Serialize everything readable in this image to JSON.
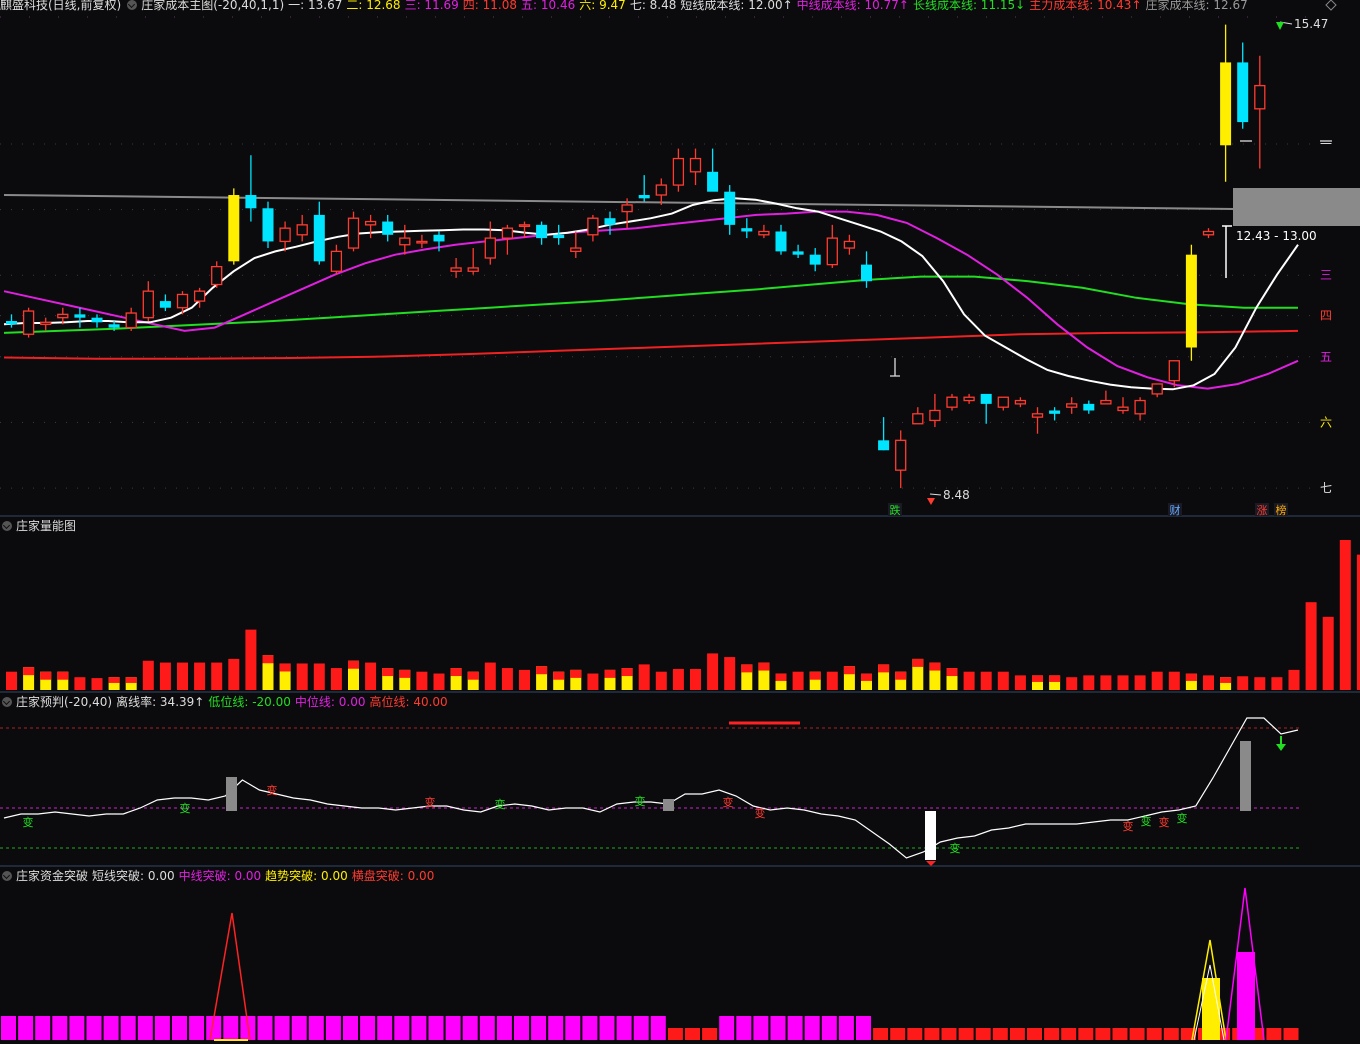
{
  "colors": {
    "up": "#ff3b30",
    "down": "#00e5ff",
    "ma5": "#ffffff",
    "ma20": "#e020e0",
    "ma60": "#22dd22",
    "ma120": "#ee2222",
    "grey": "#888888",
    "yellow": "#ffee00"
  },
  "main_header": {
    "title": "麒盛科技(日线,前复权)",
    "indicator": "庄家成本主图(-20,40,1,1)",
    "items": [
      {
        "label": "一: 13.67",
        "color": "#dddddd"
      },
      {
        "label": "二: 12.68",
        "color": "#ffee00"
      },
      {
        "label": "三: 11.69",
        "color": "#e020e0"
      },
      {
        "label": "四: 11.08",
        "color": "#ff3b30"
      },
      {
        "label": "五: 10.46",
        "color": "#e020e0"
      },
      {
        "label": "六: 9.47",
        "color": "#ffee00"
      },
      {
        "label": "七: 8.48",
        "color": "#dddddd"
      },
      {
        "label": "短线成本线: 12.00↑",
        "color": "#dddddd"
      },
      {
        "label": "中线成本线: 10.77↑",
        "color": "#e020e0"
      },
      {
        "label": "长线成本线: 11.15↓",
        "color": "#22dd22"
      },
      {
        "label": "主力成本线: 10.43↑",
        "color": "#ff3b30"
      },
      {
        "label": "庄家成本线: 12.67",
        "color": "#999999"
      }
    ]
  },
  "price_levels": [
    {
      "label": "一",
      "value": 13.67,
      "color": "#dddddd"
    },
    {
      "label": "二",
      "value": 12.68,
      "color": "#ffee00"
    },
    {
      "label": "三",
      "value": 11.69,
      "color": "#e020e0"
    },
    {
      "label": "四",
      "value": 11.08,
      "color": "#ff3b30"
    },
    {
      "label": "五",
      "value": 10.46,
      "color": "#e020e0"
    },
    {
      "label": "六",
      "value": 9.47,
      "color": "#ffee00"
    },
    {
      "label": "七",
      "value": 8.48,
      "color": "#dddddd"
    }
  ],
  "annotations": {
    "high": "15.47",
    "low": "8.48",
    "range": "12.43 - 13.00"
  },
  "markers": [
    {
      "text": "跌",
      "color": "#22dd22"
    },
    {
      "text": "财",
      "color": "#66aaff"
    },
    {
      "text": "涨",
      "color": "#ff3b30"
    },
    {
      "text": "榜",
      "color": "#ffaa00"
    }
  ],
  "vol_header": {
    "title": "庄家量能图"
  },
  "pred_header": {
    "title": "庄家预判(-20,40)",
    "deviation": "离线率: 34.39↑",
    "low_line": "低位线: -20.00",
    "mid_line": "中位线: 0.00",
    "high_line": "高位线: 40.00"
  },
  "pred_signal_text": "变",
  "fund_header": {
    "title": "庄家资金突破",
    "short": "短线突破: 0.00",
    "mid": "中线突破: 0.00",
    "trend": "趋势突破: 0.00",
    "horizontal": "横盘突破: 0.00"
  },
  "chart_data": [
    {
      "type": "candlestick",
      "title": "麒盛科技(日线,前复权)",
      "ohlc": [
        [
          11.0,
          11.1,
          10.9,
          10.95
        ],
        [
          10.8,
          11.2,
          10.75,
          11.15
        ],
        [
          10.95,
          11.05,
          10.85,
          10.98
        ],
        [
          11.05,
          11.2,
          10.95,
          11.1
        ],
        [
          11.1,
          11.2,
          10.9,
          11.05
        ],
        [
          11.05,
          11.1,
          10.9,
          10.98
        ],
        [
          10.95,
          11.0,
          10.85,
          10.9
        ],
        [
          10.9,
          11.2,
          10.85,
          11.12
        ],
        [
          11.05,
          11.6,
          11.0,
          11.45
        ],
        [
          11.3,
          11.4,
          11.15,
          11.2
        ],
        [
          11.2,
          11.45,
          11.1,
          11.4
        ],
        [
          11.3,
          11.5,
          11.2,
          11.45
        ],
        [
          11.55,
          11.9,
          11.5,
          11.82
        ],
        [
          11.9,
          13.0,
          11.85,
          12.9
        ],
        [
          12.9,
          13.5,
          12.5,
          12.7
        ],
        [
          12.7,
          12.8,
          12.1,
          12.2
        ],
        [
          12.2,
          12.5,
          12.05,
          12.4
        ],
        [
          12.3,
          12.6,
          12.2,
          12.45
        ],
        [
          12.6,
          12.8,
          11.85,
          11.9
        ],
        [
          11.75,
          12.15,
          11.7,
          12.05
        ],
        [
          12.1,
          12.65,
          12.05,
          12.55
        ],
        [
          12.45,
          12.6,
          12.25,
          12.5
        ],
        [
          12.5,
          12.6,
          12.2,
          12.3
        ],
        [
          12.15,
          12.45,
          12.0,
          12.25
        ],
        [
          12.2,
          12.3,
          12.1,
          12.2
        ],
        [
          12.3,
          12.35,
          12.05,
          12.2
        ],
        [
          11.75,
          11.95,
          11.65,
          11.8
        ],
        [
          11.75,
          12.1,
          11.7,
          11.8
        ],
        [
          11.95,
          12.5,
          11.85,
          12.25
        ],
        [
          12.25,
          12.45,
          12.0,
          12.4
        ],
        [
          12.45,
          12.5,
          12.25,
          12.45
        ],
        [
          12.45,
          12.5,
          12.15,
          12.25
        ],
        [
          12.3,
          12.45,
          12.15,
          12.25
        ],
        [
          12.05,
          12.35,
          11.95,
          12.1
        ],
        [
          12.3,
          12.6,
          12.2,
          12.55
        ],
        [
          12.55,
          12.65,
          12.3,
          12.45
        ],
        [
          12.65,
          12.85,
          12.4,
          12.75
        ],
        [
          12.9,
          13.2,
          12.8,
          12.85
        ],
        [
          12.9,
          13.15,
          12.75,
          13.05
        ],
        [
          13.05,
          13.6,
          12.95,
          13.45
        ],
        [
          13.25,
          13.6,
          13.05,
          13.45
        ],
        [
          13.25,
          13.6,
          13.0,
          12.95
        ],
        [
          12.95,
          13.05,
          12.3,
          12.45
        ],
        [
          12.4,
          12.55,
          12.25,
          12.35
        ],
        [
          12.3,
          12.45,
          12.25,
          12.35
        ],
        [
          12.35,
          12.45,
          12.0,
          12.05
        ],
        [
          12.05,
          12.15,
          11.95,
          12.0
        ],
        [
          12.0,
          12.1,
          11.75,
          11.85
        ],
        [
          11.85,
          12.45,
          11.8,
          12.25
        ],
        [
          12.1,
          12.3,
          12.0,
          12.2
        ],
        [
          11.85,
          12.05,
          11.5,
          11.6
        ],
        [
          9.2,
          9.55,
          9.05,
          9.05
        ],
        [
          8.75,
          9.35,
          8.48,
          9.2
        ],
        [
          9.45,
          9.7,
          9.45,
          9.6
        ],
        [
          9.5,
          9.9,
          9.4,
          9.65
        ],
        [
          9.7,
          9.9,
          9.65,
          9.85
        ],
        [
          9.8,
          9.9,
          9.75,
          9.85
        ],
        [
          9.9,
          9.85,
          9.45,
          9.75
        ],
        [
          9.7,
          9.85,
          9.65,
          9.85
        ],
        [
          9.75,
          9.85,
          9.7,
          9.8
        ],
        [
          9.55,
          9.7,
          9.3,
          9.6
        ],
        [
          9.65,
          9.7,
          9.5,
          9.6
        ],
        [
          9.7,
          9.85,
          9.6,
          9.75
        ],
        [
          9.75,
          9.8,
          9.6,
          9.65
        ],
        [
          9.75,
          9.95,
          9.75,
          9.8
        ],
        [
          9.65,
          9.85,
          9.6,
          9.7
        ],
        [
          9.6,
          9.85,
          9.5,
          9.8
        ],
        [
          9.9,
          10.0,
          9.85,
          10.05
        ],
        [
          10.1,
          10.3,
          10.0,
          10.4
        ],
        [
          10.6,
          12.15,
          10.4,
          12.0
        ],
        [
          12.3,
          12.4,
          12.25,
          12.35
        ],
        [
          13.65,
          15.47,
          13.1,
          14.9
        ],
        [
          14.9,
          15.2,
          13.9,
          14.0
        ],
        [
          14.2,
          15.0,
          13.3,
          14.55
        ]
      ],
      "ma_short": [
        10.95,
        10.97,
        10.97,
        10.98,
        11.0,
        11.0,
        10.98,
        10.98,
        11.05,
        11.2,
        11.5,
        11.75,
        11.95,
        12.05,
        12.12,
        12.2,
        12.27,
        12.32,
        12.34,
        12.35,
        12.36,
        12.37,
        12.38,
        12.38,
        12.37,
        12.33,
        12.3,
        12.33,
        12.38,
        12.45,
        12.5,
        12.55,
        12.62,
        12.75,
        12.82,
        12.85,
        12.83,
        12.77,
        12.7,
        12.65,
        12.55,
        12.45,
        12.35,
        12.2,
        11.98,
        11.6,
        11.1,
        10.78,
        10.6,
        10.42,
        10.26,
        10.17,
        10.1,
        10.04,
        10.0,
        9.98,
        9.97,
        10.03,
        10.2,
        10.6,
        11.2,
        11.7,
        12.15
      ],
      "ma_mid": [
        11.45,
        11.35,
        11.25,
        11.15,
        11.05,
        10.95,
        10.85,
        10.9,
        11.1,
        11.3,
        11.5,
        11.7,
        11.87,
        12.0,
        12.08,
        12.15,
        12.2,
        12.25,
        12.3,
        12.34,
        12.37,
        12.4,
        12.45,
        12.5,
        12.55,
        12.6,
        12.62,
        12.65,
        12.65,
        12.6,
        12.48,
        12.25,
        12.0,
        11.7,
        11.35,
        10.95,
        10.6,
        10.32,
        10.15,
        10.03,
        9.98,
        10.05,
        10.2,
        10.4
      ],
      "ma_long": [
        10.82,
        10.85,
        10.88,
        10.92,
        10.96,
        11.0,
        11.05,
        11.1,
        11.15,
        11.2,
        11.25,
        11.3,
        11.36,
        11.42,
        11.48,
        11.55,
        11.62,
        11.67,
        11.67,
        11.6,
        11.5,
        11.35,
        11.25,
        11.2,
        11.2
      ],
      "ma_main": [
        10.45,
        10.43,
        10.43,
        10.44,
        10.46,
        10.5,
        10.55,
        10.6,
        10.65,
        10.7,
        10.75,
        10.8,
        10.82,
        10.83,
        10.85
      ],
      "dealer_cost": [
        12.67
      ],
      "x_range": [
        0,
        73
      ],
      "y_range": [
        8.3,
        15.6
      ]
    },
    {
      "type": "bar",
      "title": "庄家量能图",
      "values": [
        1.0,
        1.25,
        1.0,
        1.0,
        0.7,
        0.65,
        0.7,
        0.7,
        1.6,
        1.5,
        1.5,
        1.5,
        1.5,
        1.7,
        3.3,
        1.9,
        1.45,
        1.45,
        1.45,
        1.2,
        1.6,
        1.5,
        1.2,
        1.1,
        1.0,
        0.9,
        1.2,
        1.0,
        1.5,
        1.2,
        1.1,
        1.3,
        1.0,
        1.1,
        0.9,
        1.1,
        1.2,
        1.4,
        1.0,
        1.15,
        1.15,
        2.0,
        1.8,
        1.4,
        1.5,
        0.9,
        1.0,
        1.0,
        1.0,
        1.3,
        0.9,
        1.4,
        1.0,
        1.7,
        1.5,
        1.2,
        1.0,
        1.0,
        1.0,
        0.8,
        0.8,
        0.8,
        0.7,
        0.8,
        0.8,
        0.8,
        0.8,
        1.0,
        1.0,
        0.9,
        0.8,
        0.7,
        0.75,
        0.7,
        0.7,
        1.1,
        4.8,
        4.0,
        8.2,
        7.4,
        5.4
      ],
      "up_flags": [
        1,
        0,
        0,
        0,
        1,
        1,
        0,
        0,
        1,
        1,
        1,
        1,
        1,
        1,
        1,
        0,
        0,
        1,
        1,
        1,
        0,
        1,
        0,
        0,
        1,
        1,
        0,
        0,
        1,
        1,
        1,
        0,
        0,
        0,
        1,
        0,
        0,
        1,
        1,
        1,
        1,
        1,
        1,
        0,
        0,
        0,
        1,
        0,
        1,
        0,
        0,
        0,
        0,
        0,
        0,
        0,
        1,
        1,
        1,
        1,
        0,
        0,
        1,
        1,
        1,
        1,
        1,
        1,
        1,
        0,
        1,
        0,
        1,
        1,
        1,
        1,
        1,
        1,
        1,
        1,
        1
      ]
    },
    {
      "type": "line",
      "title": "庄家预判(-20,40)",
      "values": [
        -5,
        -3,
        -3,
        -2,
        -3,
        -4,
        -3,
        -3,
        0,
        4,
        5,
        5,
        4,
        6,
        14,
        9,
        7,
        5,
        4,
        2,
        1,
        0,
        0,
        -1,
        0,
        1,
        1,
        -1,
        -2,
        1,
        2,
        1,
        -1,
        0,
        0,
        -2,
        2,
        3,
        3,
        2,
        7,
        7,
        9,
        6,
        1,
        -1,
        0,
        -1,
        -3,
        -4,
        -6,
        -12,
        -18,
        -25,
        -22,
        -17,
        -15,
        -14,
        -11,
        -10,
        -8,
        -8,
        -8,
        -8,
        -7,
        -6,
        -6,
        -4,
        -2,
        -1,
        1,
        15,
        30,
        45,
        45,
        37,
        39
      ],
      "ylim": [
        -25,
        45
      ],
      "low_line": -20,
      "mid_line": 0,
      "high_line": 40
    },
    {
      "type": "bar",
      "title": "庄家资金突破",
      "series": [
        {
          "name": "短线突破",
          "values": [
            0
          ]
        },
        {
          "name": "中线突破",
          "values": [
            0
          ]
        },
        {
          "name": "趋势突破",
          "values": [
            0
          ]
        },
        {
          "name": "横盘突破",
          "values": [
            0
          ]
        }
      ]
    }
  ]
}
